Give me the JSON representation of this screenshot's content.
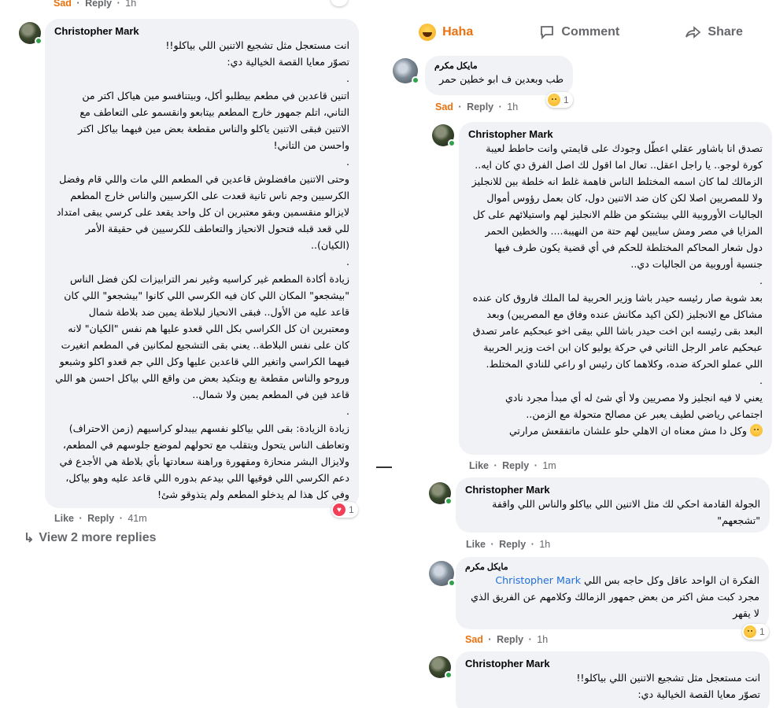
{
  "top_left": {
    "sad": "Sad",
    "reply": "Reply",
    "time": "1h"
  },
  "post_bar": {
    "haha": "Haha",
    "comment": "Comment",
    "share": "Share"
  },
  "left_comment": {
    "author": "Christopher Mark",
    "paragraphs": [
      "انت مستعجل مثل تشجيع الاتنين اللي بياكلو!!",
      "تصوّر معايا القصة الخيالية دي:",
      ".",
      "اتنين قاعدين في مطعم بيطلبو أكل، وبيتنافسو مين هياكل اكتر من التاني، اتلم جمهور خارج المطعم بيتابعو وانقسمو على التعاطف مع الاتنين فبقى الاتنين ياكلو والناس مقطعة بعض مين فيهما بياكل اكتر واحسن من التاني!",
      ".",
      "وحتى الاتنين مافضلوش قاعدين في المطعم اللي مات واللي قام وفضل الكرسيين وجم ناس تانية قعدت على الكرسيين والناس خارج المطعم لايزالو منقسمين وبقو معتبرين ان كل واحد يقعد على كرسي يبقى امتداد للي قعد قبله فتحول الانحياز والتعاطف للكرسيين في حقيقة الأمر (الكيان)..",
      ".",
      "زيادة أكادة المطعم غير كراسيه وغير نمر الترابيزات لكن فضل الناس \"بيشجعو\" المكان اللي كان فيه الكرسي اللي كانوا \"بيشجعو\" اللي كان قاعد عليه من الأول.. فبقى الانحياز لبلاطة يمين ضد بلاطة شمال ومعتبرين ان كل الكراسي بكل اللي قعدو عليها هم نفس \"الكيان\" لانه كان على نفس البلاطة.. يعني بقى التشجيع لمكانين في المطعم اتغيرت فيهما الكراسي واتغير اللي قاعدين عليها وكل اللي جم قعدو اكلو وشبعو وروحو والناس مقطعة بع وبتكيد بعض من واقع اللي بياكل احسن هو اللي قاعد فين في المطعم يمين ولا شمال..",
      ".",
      "زيادة الزيادة: بقى اللي بياكلو نفسهم بيبدلو كراسيهم (زمن الاحتراف) وتعاطف الناس يتحول ويتقلب مع تحولهم لموضع جلوسهم في المطعم، ولايزال البشر منحازة ومقهورة وراهنة سعادتها بأي بلاطة هي الأجدع في دعم الكرسي اللي فوقيها اللي بيدعم بدوره اللي قاعد عليه وهو بياكل، وفي كل هذا لم يدخلو المطعم ولم يتذوقو شئ!"
    ],
    "like": "Like",
    "reply": "Reply",
    "time": "41m",
    "reaction_count": "1"
  },
  "view_more": "View 2 more replies",
  "reply1": {
    "author": "مايكل مكرم",
    "text": "طب وبعدين ف ابو خطين حمر",
    "sad": "Sad",
    "reply": "Reply",
    "time": "1h",
    "reaction_count": "1"
  },
  "reply2": {
    "author": "Christopher Mark",
    "paragraphs": [
      "تصدق انا باشاور عقلي اعطّل وجودك على قايمتي وانت حاطط لعيبة كورة لوجو.. يا راجل اعقل.. تعال اما اقول لك اصل الفرق دي كان ايه.. الزمالك لما كان اسمه المختلط الناس فاهمة غلط انه خلطة بين للانجليز ولا للمصريين اصلا لكن كان ضد الاتنين دول، كان بعمل رؤوس أموال الجاليات الأوروبية اللي بيشتكو من ظلم الانجليز لهم واستيلائهم على كل المزايا في مصر ومش سايبين لهم حتة من النهيبة.... والخطين الحمر دول شعار المحاكم المختلطة للحكم في أي قضية يكون طرف فيها جنسية أوروبية من الجاليات دي..",
      ".",
      "بعد شوية صار رئيسه حيدر باشا وزير الحربية لما الملك فاروق كان عنده مشاكل مع الانجليز (لكن اكيد مكانش عنده وفاق مع المصريين) وبعد البعد بقى رئيسه ابن اخت حيدر باشا اللي بيقى اخو عبحكيم عامر تصدق عبحكيم عامر الرجل الثاني في حركة يوليو كان ابن اخت وزير الحربية اللي عملو الحركة ضده، وكلاهما كان رئيس او راعي للنادي المختلط.",
      ".",
      "يعني لا فيه انجليز ولا مصريين ولا أي شئ له أي مبدأ مجرد نادي اجتماعي رياضي لطيف يعبر عن مصالح متحولة مع الزمن..",
      "وكل دا مش معناه ان الاهلي حلو علشان ماتفقعش مرارتي"
    ],
    "like": "Like",
    "reply": "Reply",
    "time": "1m"
  },
  "reply3": {
    "author": "Christopher Mark",
    "text": "الجولة القادمة احكي لك مثل الاتنين اللي بياكلو والناس اللي واقفة \"تشجعهم\"",
    "like": "Like",
    "reply": "Reply",
    "time": "1h"
  },
  "reply4": {
    "author": "مايكل مكرم",
    "mention": "Christopher Mark",
    "text_after_mention": "الفكرة ان الواحد عاقل وكل حاجه بس اللي",
    "text": "مجرد كبت مش اكتر من بعض جمهور الزمالك وكلامهم عن الفريق الذي لا يقهر",
    "sad": "Sad",
    "reply": "Reply",
    "time": "1h",
    "reaction_count": "1"
  },
  "reply5": {
    "author": "Christopher Mark",
    "paragraphs": [
      "انت مستعجل مثل تشجيع الاتنين اللي بياكلو!!",
      "تصوّر معايا القصة الخيالية دي:"
    ]
  }
}
